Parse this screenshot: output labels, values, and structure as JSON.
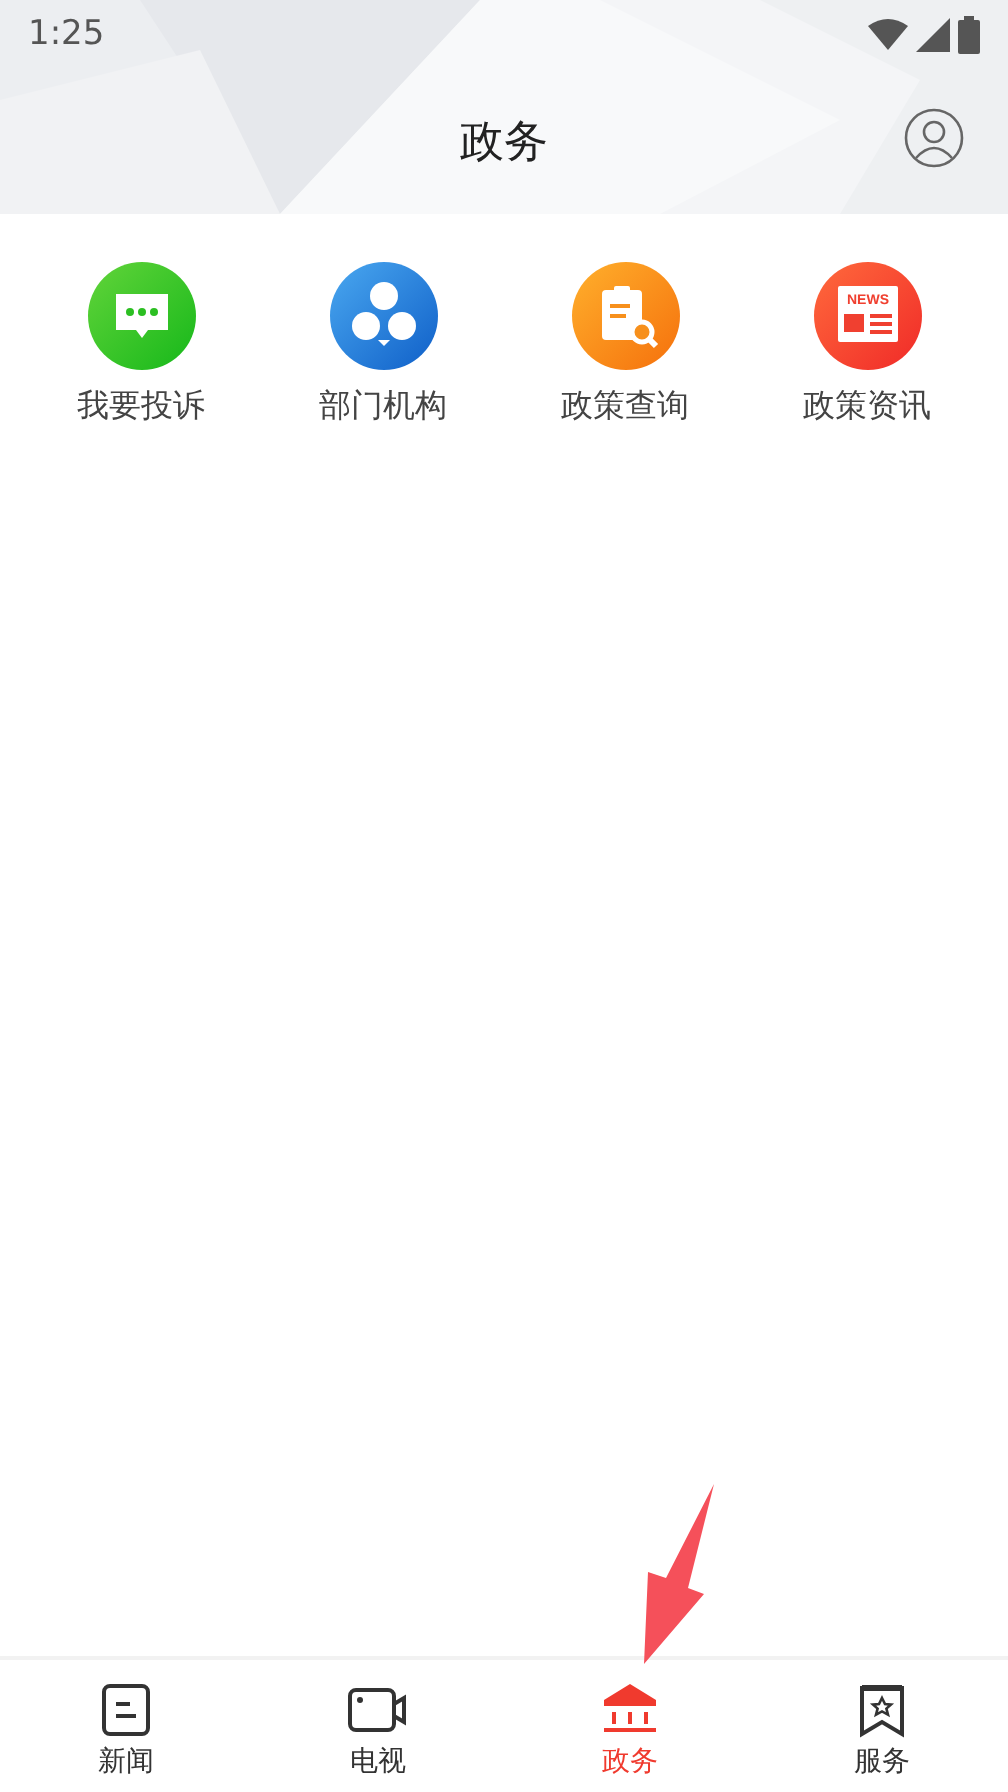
{
  "status_bar": {
    "time": "1:25"
  },
  "header": {
    "title": "政务"
  },
  "services": [
    {
      "kind": "complaint",
      "label": "我要投诉"
    },
    {
      "kind": "departments",
      "label": "部门机构"
    },
    {
      "kind": "policy-search",
      "label": "政策查询"
    },
    {
      "kind": "news",
      "label": "政策资讯",
      "icon_text": "NEWS"
    }
  ],
  "tabs": [
    {
      "kind": "news",
      "label": "新闻",
      "selected": false
    },
    {
      "kind": "tv",
      "label": "电视",
      "selected": false
    },
    {
      "kind": "government",
      "label": "政务",
      "selected": true
    },
    {
      "kind": "services",
      "label": "服务",
      "selected": false
    }
  ]
}
